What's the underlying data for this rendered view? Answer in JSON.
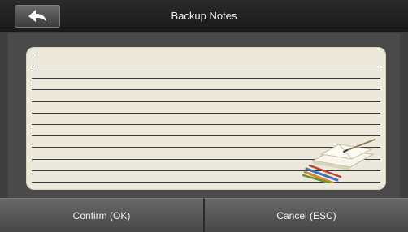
{
  "header": {
    "title": "Backup Notes",
    "back_icon": "back-arrow-icon"
  },
  "editor": {
    "text": "",
    "line_count": 11,
    "decoration_icon": "notebook-pencils-icon"
  },
  "footer": {
    "confirm_label": "Confirm (OK)",
    "cancel_label": "Cancel (ESC)"
  },
  "colors": {
    "title_bar": "#1f1f1f",
    "panel": "#4a4a4a",
    "notepad": "#ece9dc",
    "button": "#5a5a5a"
  }
}
